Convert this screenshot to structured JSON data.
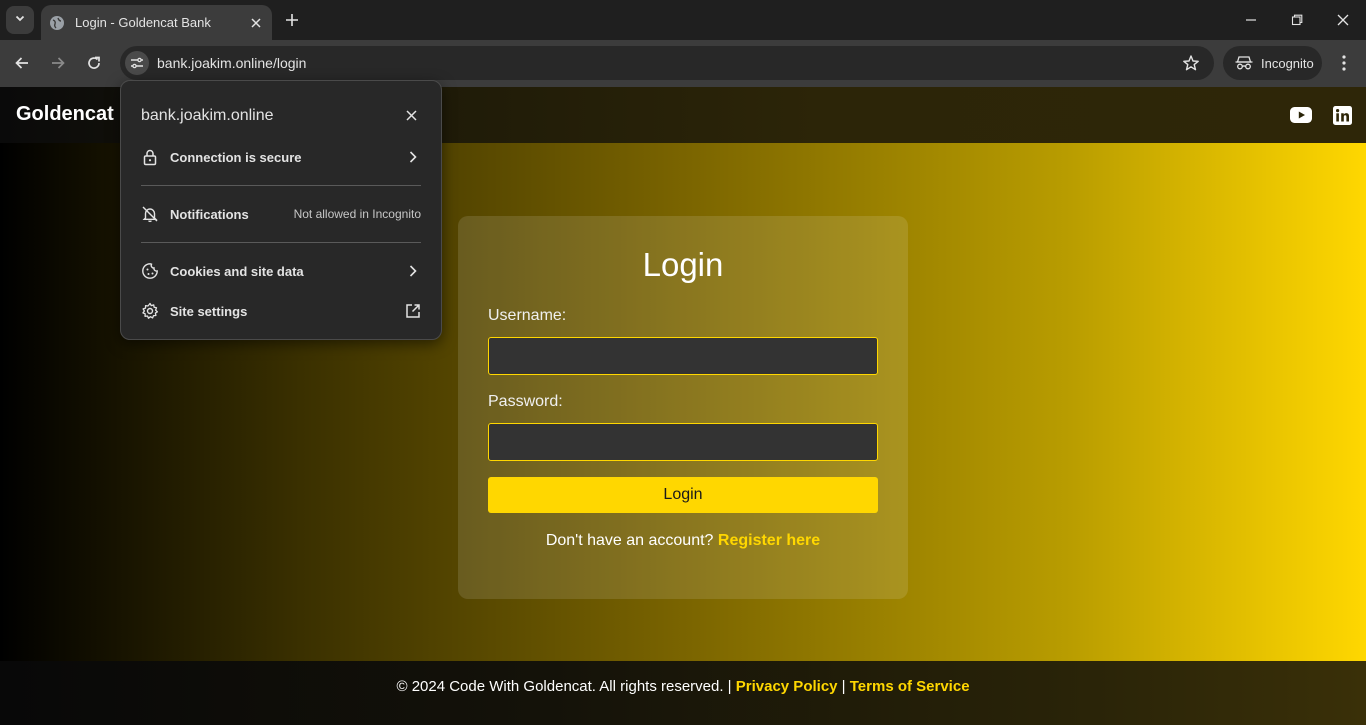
{
  "browser": {
    "tab_title": "Login - Goldencat Bank",
    "url": "bank.joakim.online/login",
    "incognito_label": "Incognito"
  },
  "popup": {
    "title": "bank.joakim.online",
    "connection_label": "Connection is secure",
    "notifications_label": "Notifications",
    "notifications_value": "Not allowed in Incognito",
    "cookies_label": "Cookies and site data",
    "site_settings_label": "Site settings"
  },
  "header": {
    "brand": "Goldencat"
  },
  "login": {
    "title": "Login",
    "username_label": "Username:",
    "username_value": "",
    "password_label": "Password:",
    "password_value": "",
    "button_label": "Login",
    "register_prompt": "Don't have an account?",
    "register_link": "Register here"
  },
  "footer": {
    "copyright": "© 2024 Code With Goldencat. All rights reserved. |",
    "privacy_link": "Privacy Policy",
    "separator": "|",
    "terms_link": "Terms of Service"
  },
  "icons": {
    "tab_search": "chevron-down-icon",
    "favicon": "globe-icon",
    "tab_close": "close-icon",
    "new_tab": "plus-icon",
    "minimize": "minimize-icon",
    "restore": "restore-icon",
    "close_window": "close-icon",
    "back": "arrow-left-icon",
    "forward": "arrow-right-icon",
    "reload": "reload-icon",
    "site_info": "tune-icon",
    "bookmark": "star-icon",
    "incognito": "incognito-icon",
    "menu": "more-vert-icon",
    "youtube": "youtube-icon",
    "linkedin": "linkedin-icon",
    "lock": "lock-icon",
    "notifications_off": "bell-off-icon",
    "cookie": "cookie-icon",
    "settings": "gear-icon",
    "external": "open-in-new-icon"
  },
  "colors": {
    "accent": "#ffd700",
    "chrome_dark": "#1f1f1f",
    "chrome_toolbar": "#3c3c3c",
    "popup_bg": "#282828"
  }
}
